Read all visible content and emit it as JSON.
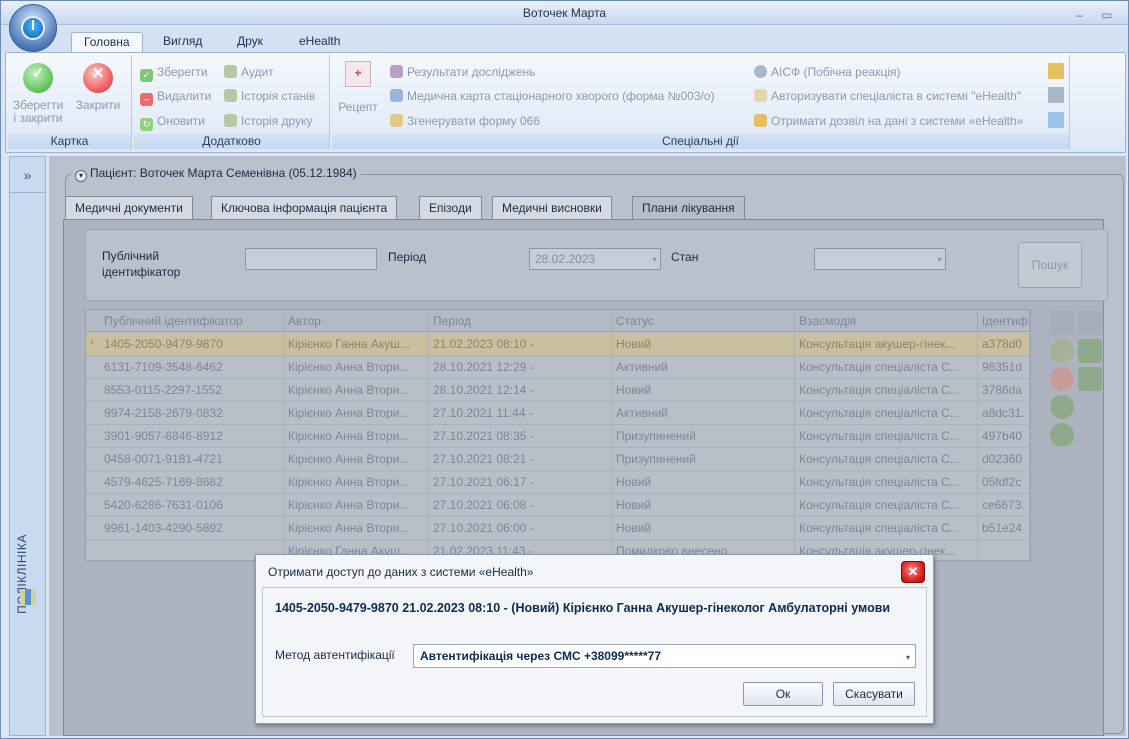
{
  "window": {
    "title": "Вoточек Марта",
    "minimize": "–",
    "restore": "▭"
  },
  "ribbon_tabs": [
    "Головна",
    "Вигляд",
    "Друк",
    "eHealth"
  ],
  "ribbon": {
    "save_close": "Зберегти і закрити",
    "close": "Закрити",
    "group_card": "Картка",
    "save": "Зберегти",
    "delete": "Видалити",
    "refresh": "Оновити",
    "audit": "Аудит",
    "state_history": "Історія станів",
    "print_history": "Історія друку",
    "group_extra": "Додатково",
    "recipe": "Рецепт",
    "research_results": "Результати досліджень",
    "medical_card": "Медична карта стаціонарного хворого (форма №003/о)",
    "generate_form": "Згенерувати форму 066",
    "aisf": "АІСФ (Побічна реакція)",
    "authorize": "Авторизувати спеціаліста в системі \"eHealth\"",
    "get_permission": "Отримати дозвіл на дані з системи «eHealth»",
    "group_special": "Спеціальні дії"
  },
  "sidebar": {
    "expand": "»",
    "label": "ПОЛІКЛІНІКА"
  },
  "patient": {
    "title": "Пацієнт: Воточек Марта Семенівна (05.12.1984)"
  },
  "content_tabs": [
    "Медичні документи",
    "Ключова інформація пацієнта",
    "Епізоди",
    "Медичні висновки",
    "Плани лікування"
  ],
  "filter": {
    "public_id_label": "Публічний ідентифікатор",
    "period_label": "Період",
    "period_value": "28.02.2023",
    "state_label": "Стан",
    "search_button": "Пошук"
  },
  "table": {
    "headers": [
      "Публічний ідентифікатор",
      "Автор",
      "Період",
      "Статус",
      "Взаємодія",
      "Ідентиф"
    ],
    "rows": [
      [
        "1405-2050-9479-9870",
        "Кірієнко Ганна Акуш...",
        "21.02.2023 08:10 -",
        "Новий",
        "Консультація акушер-гінек...",
        "a378d0"
      ],
      [
        "6131-7109-3548-6462",
        "Кірієнко Анна Втори...",
        "28.10.2021 12:29 -",
        "Активний",
        "Консультація спеціаліста С...",
        "98351d"
      ],
      [
        "8553-0115-2297-1552",
        "Кірієнко Анна Втори...",
        "28.10.2021 12:14 -",
        "Новий",
        "Консультація спеціаліста С...",
        "3786da"
      ],
      [
        "9974-2158-2679-0832",
        "Кірієнко Анна Втори...",
        "27.10.2021 11:44 -",
        "Активний",
        "Консультація спеціаліста С...",
        "a8dc31."
      ],
      [
        "3901-9057-6846-8912",
        "Кірієнко Анна Втори...",
        "27.10.2021 08:35 -",
        "Призупинений",
        "Консультація спеціаліста С...",
        "497b40"
      ],
      [
        "0458-0071-9181-4721",
        "Кірієнко Анна Втори...",
        "27.10.2021 08:21 -",
        "Призупинений",
        "Консультація спеціаліста С...",
        "d02360"
      ],
      [
        "4579-4625-7169-8682",
        "Кірієнко Анна Втори...",
        "27.10.2021 06:17 -",
        "Новий",
        "Консультація спеціаліста С...",
        "05fdf2c"
      ],
      [
        "5420-6286-7631-0106",
        "Кірієнко Анна Втори...",
        "27.10.2021 06:08 -",
        "Новий",
        "Консультація спеціаліста С...",
        "ce6673."
      ],
      [
        "9961-1403-4290-5892",
        "Кірієнко Анна Втори...",
        "27.10.2021 06:00 -",
        "Новий",
        "Консультація спеціаліста С...",
        "b51e24"
      ],
      [
        "",
        "Кірієнко Ганна Акуш...",
        "21.02.2023 11:43 -",
        "Помилково внесено",
        "Консультація акушер-гінек...",
        ""
      ]
    ]
  },
  "dialog": {
    "title": "Отримати доступ до даних з системи «eHealth»",
    "message": "1405-2050-9479-9870 21.02.2023 08:10 - (Новий) Кірієнко Ганна Акушер-гінеколог Амбулаторні умови",
    "auth_label": "Метод автентифікації",
    "auth_value": "Автентифікація через СМС  +38099*****77",
    "ok": "Ок",
    "cancel": "Скасувати"
  },
  "colors": {
    "accent": "#1d4f9c",
    "close_red": "#d92020"
  }
}
